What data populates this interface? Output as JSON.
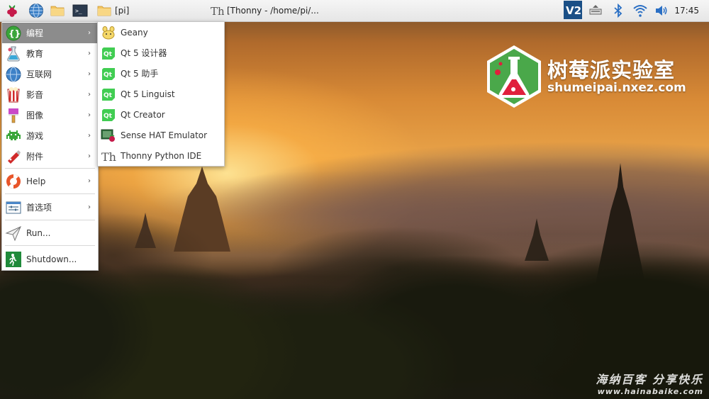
{
  "taskbar": {
    "launchers": [
      {
        "icon": "raspberry-menu-icon"
      },
      {
        "icon": "web-browser-icon"
      },
      {
        "icon": "file-manager-icon"
      },
      {
        "icon": "terminal-icon"
      }
    ],
    "tasks": [
      {
        "label": "[pi]",
        "icon": "folder-icon"
      },
      {
        "label": "[Thonny  -  /home/pi/...",
        "icon": "thonny-icon"
      }
    ],
    "tray": [
      "vnc-icon",
      "eject-icon",
      "bluetooth-icon",
      "wifi-icon",
      "volume-icon"
    ],
    "clock": "17:45"
  },
  "main_menu": {
    "items": [
      {
        "label": "编程",
        "icon": "programming-icon",
        "submenu": true,
        "active": true
      },
      {
        "label": "教育",
        "icon": "education-icon",
        "submenu": true
      },
      {
        "label": "互联网",
        "icon": "internet-icon",
        "submenu": true
      },
      {
        "label": "影音",
        "icon": "sound-video-icon",
        "submenu": true
      },
      {
        "label": "图像",
        "icon": "graphics-icon",
        "submenu": true
      },
      {
        "label": "游戏",
        "icon": "games-icon",
        "submenu": true
      },
      {
        "label": "附件",
        "icon": "accessories-icon",
        "submenu": true
      },
      {
        "label": "Help",
        "icon": "help-icon",
        "submenu": true
      },
      {
        "label": "首选项",
        "icon": "preferences-icon",
        "submenu": true
      },
      {
        "label": "Run...",
        "icon": "run-icon",
        "submenu": false
      },
      {
        "label": "Shutdown...",
        "icon": "shutdown-icon",
        "submenu": false
      }
    ],
    "arrow": "›"
  },
  "submenu": {
    "items": [
      {
        "label": "Geany",
        "icon": "geany-icon"
      },
      {
        "label": "Qt 5 设计器",
        "icon": "qt-icon"
      },
      {
        "label": "Qt 5 助手",
        "icon": "qt-icon"
      },
      {
        "label": "Qt 5 Linguist",
        "icon": "qt-icon"
      },
      {
        "label": "Qt Creator",
        "icon": "qt-icon"
      },
      {
        "label": "Sense HAT Emulator",
        "icon": "sense-hat-icon"
      },
      {
        "label": "Thonny Python IDE",
        "icon": "thonny-icon"
      }
    ],
    "qt_glyph": "Qt"
  },
  "desktop": {
    "logo_title": "树莓派实验室",
    "logo_url": "shumeipai.nxez.com",
    "watermark_line1": "海纳百客 分享快乐",
    "watermark_line2": "www.hainabaike.com"
  },
  "colors": {
    "menu_highlight": "#8c8c8c",
    "logo_hex": "#4aa84a",
    "logo_flask": "#e0203c"
  }
}
